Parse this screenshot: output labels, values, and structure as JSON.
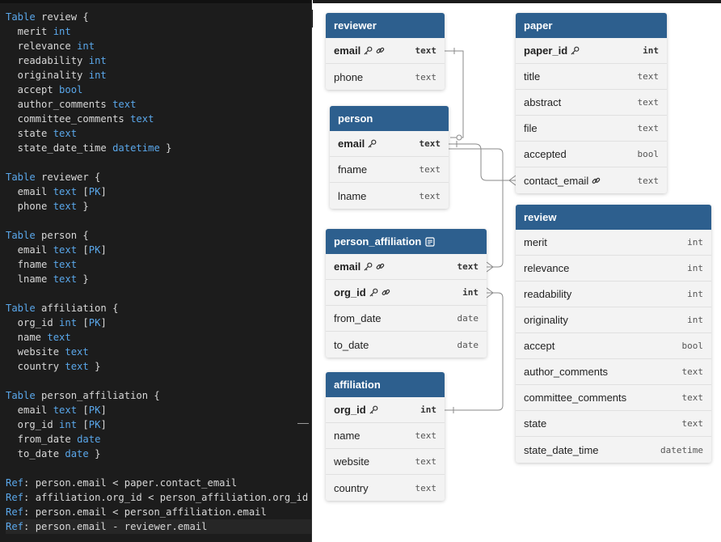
{
  "editor": {
    "lines": [
      [
        {
          "c": "k",
          "t": "Table"
        },
        {
          "c": "p",
          "t": " review {"
        }
      ],
      [
        {
          "c": "p",
          "t": "  merit "
        },
        {
          "c": "t",
          "t": "int"
        }
      ],
      [
        {
          "c": "p",
          "t": "  relevance "
        },
        {
          "c": "t",
          "t": "int"
        }
      ],
      [
        {
          "c": "p",
          "t": "  readability "
        },
        {
          "c": "t",
          "t": "int"
        }
      ],
      [
        {
          "c": "p",
          "t": "  originality "
        },
        {
          "c": "t",
          "t": "int"
        }
      ],
      [
        {
          "c": "p",
          "t": "  accept "
        },
        {
          "c": "t",
          "t": "bool"
        }
      ],
      [
        {
          "c": "p",
          "t": "  author_comments "
        },
        {
          "c": "t",
          "t": "text"
        }
      ],
      [
        {
          "c": "p",
          "t": "  committee_comments "
        },
        {
          "c": "t",
          "t": "text"
        }
      ],
      [
        {
          "c": "p",
          "t": "  state "
        },
        {
          "c": "t",
          "t": "text"
        }
      ],
      [
        {
          "c": "p",
          "t": "  state_date_time "
        },
        {
          "c": "t",
          "t": "datetime"
        },
        {
          "c": "p",
          "t": " }"
        }
      ],
      [],
      [
        {
          "c": "k",
          "t": "Table"
        },
        {
          "c": "p",
          "t": " reviewer {"
        }
      ],
      [
        {
          "c": "p",
          "t": "  email "
        },
        {
          "c": "t",
          "t": "text"
        },
        {
          "c": "p",
          "t": " ["
        },
        {
          "c": "k",
          "t": "PK"
        },
        {
          "c": "p",
          "t": "]"
        }
      ],
      [
        {
          "c": "p",
          "t": "  phone "
        },
        {
          "c": "t",
          "t": "text"
        },
        {
          "c": "p",
          "t": " }"
        }
      ],
      [],
      [
        {
          "c": "k",
          "t": "Table"
        },
        {
          "c": "p",
          "t": " person {"
        }
      ],
      [
        {
          "c": "p",
          "t": "  email "
        },
        {
          "c": "t",
          "t": "text"
        },
        {
          "c": "p",
          "t": " ["
        },
        {
          "c": "k",
          "t": "PK"
        },
        {
          "c": "p",
          "t": "]"
        }
      ],
      [
        {
          "c": "p",
          "t": "  fname "
        },
        {
          "c": "t",
          "t": "text"
        }
      ],
      [
        {
          "c": "p",
          "t": "  lname "
        },
        {
          "c": "t",
          "t": "text"
        },
        {
          "c": "p",
          "t": " }"
        }
      ],
      [],
      [
        {
          "c": "k",
          "t": "Table"
        },
        {
          "c": "p",
          "t": " affiliation {"
        }
      ],
      [
        {
          "c": "p",
          "t": "  org_id "
        },
        {
          "c": "t",
          "t": "int"
        },
        {
          "c": "p",
          "t": " ["
        },
        {
          "c": "k",
          "t": "PK"
        },
        {
          "c": "p",
          "t": "]"
        }
      ],
      [
        {
          "c": "p",
          "t": "  name "
        },
        {
          "c": "t",
          "t": "text"
        }
      ],
      [
        {
          "c": "p",
          "t": "  website "
        },
        {
          "c": "t",
          "t": "text"
        }
      ],
      [
        {
          "c": "p",
          "t": "  country "
        },
        {
          "c": "t",
          "t": "text"
        },
        {
          "c": "p",
          "t": " }"
        }
      ],
      [],
      [
        {
          "c": "k",
          "t": "Table"
        },
        {
          "c": "p",
          "t": " person_affiliation {"
        }
      ],
      [
        {
          "c": "p",
          "t": "  email "
        },
        {
          "c": "t",
          "t": "text"
        },
        {
          "c": "p",
          "t": " ["
        },
        {
          "c": "k",
          "t": "PK"
        },
        {
          "c": "p",
          "t": "]"
        }
      ],
      [
        {
          "c": "p",
          "t": "  org_id "
        },
        {
          "c": "t",
          "t": "int"
        },
        {
          "c": "p",
          "t": " ["
        },
        {
          "c": "k",
          "t": "PK"
        },
        {
          "c": "p",
          "t": "]"
        }
      ],
      [
        {
          "c": "p",
          "t": "  from_date "
        },
        {
          "c": "t",
          "t": "date"
        }
      ],
      [
        {
          "c": "p",
          "t": "  to_date "
        },
        {
          "c": "t",
          "t": "date"
        },
        {
          "c": "p",
          "t": " }"
        }
      ],
      [],
      [
        {
          "c": "k",
          "t": "Ref"
        },
        {
          "c": "p",
          "t": ": person.email < paper.contact_email"
        }
      ],
      [
        {
          "c": "k",
          "t": "Ref"
        },
        {
          "c": "p",
          "t": ": affiliation.org_id < person_affiliation.org_id"
        }
      ],
      [
        {
          "c": "k",
          "t": "Ref"
        },
        {
          "c": "p",
          "t": ": person.email < person_affiliation.email"
        }
      ],
      [
        {
          "c": "k",
          "t": "Ref"
        },
        {
          "c": "p",
          "t": ": person.email - reviewer.email"
        }
      ]
    ]
  },
  "colors": {
    "header": "#2d5f8e",
    "keyword": "#5aa7ea",
    "link": "#8a8a8a"
  },
  "tables": [
    {
      "id": "reviewer",
      "name": "reviewer",
      "note_icon": false,
      "fields": [
        {
          "name": "email",
          "type": "text",
          "pk": true,
          "key_icon": true,
          "ref_icon": true
        },
        {
          "name": "phone",
          "type": "text",
          "pk": false,
          "key_icon": false,
          "ref_icon": false
        }
      ]
    },
    {
      "id": "paper",
      "name": "paper",
      "note_icon": false,
      "fields": [
        {
          "name": "paper_id",
          "type": "int",
          "pk": true,
          "key_icon": true,
          "ref_icon": false
        },
        {
          "name": "title",
          "type": "text",
          "pk": false,
          "key_icon": false,
          "ref_icon": false
        },
        {
          "name": "abstract",
          "type": "text",
          "pk": false,
          "key_icon": false,
          "ref_icon": false
        },
        {
          "name": "file",
          "type": "text",
          "pk": false,
          "key_icon": false,
          "ref_icon": false
        },
        {
          "name": "accepted",
          "type": "bool",
          "pk": false,
          "key_icon": false,
          "ref_icon": false
        },
        {
          "name": "contact_email",
          "type": "text",
          "pk": false,
          "key_icon": false,
          "ref_icon": true
        }
      ]
    },
    {
      "id": "person",
      "name": "person",
      "note_icon": false,
      "fields": [
        {
          "name": "email",
          "type": "text",
          "pk": true,
          "key_icon": true,
          "ref_icon": false
        },
        {
          "name": "fname",
          "type": "text",
          "pk": false,
          "key_icon": false,
          "ref_icon": false
        },
        {
          "name": "lname",
          "type": "text",
          "pk": false,
          "key_icon": false,
          "ref_icon": false
        }
      ]
    },
    {
      "id": "review",
      "name": "review",
      "note_icon": false,
      "fields": [
        {
          "name": "merit",
          "type": "int",
          "pk": false,
          "key_icon": false,
          "ref_icon": false
        },
        {
          "name": "relevance",
          "type": "int",
          "pk": false,
          "key_icon": false,
          "ref_icon": false
        },
        {
          "name": "readability",
          "type": "int",
          "pk": false,
          "key_icon": false,
          "ref_icon": false
        },
        {
          "name": "originality",
          "type": "int",
          "pk": false,
          "key_icon": false,
          "ref_icon": false
        },
        {
          "name": "accept",
          "type": "bool",
          "pk": false,
          "key_icon": false,
          "ref_icon": false
        },
        {
          "name": "author_comments",
          "type": "text",
          "pk": false,
          "key_icon": false,
          "ref_icon": false
        },
        {
          "name": "committee_comments",
          "type": "text",
          "pk": false,
          "key_icon": false,
          "ref_icon": false
        },
        {
          "name": "state",
          "type": "text",
          "pk": false,
          "key_icon": false,
          "ref_icon": false
        },
        {
          "name": "state_date_time",
          "type": "datetime",
          "pk": false,
          "key_icon": false,
          "ref_icon": false
        }
      ]
    },
    {
      "id": "person_affiliation",
      "name": "person_affiliation",
      "note_icon": true,
      "fields": [
        {
          "name": "email",
          "type": "text",
          "pk": true,
          "key_icon": true,
          "ref_icon": true
        },
        {
          "name": "org_id",
          "type": "int",
          "pk": true,
          "key_icon": true,
          "ref_icon": true
        },
        {
          "name": "from_date",
          "type": "date",
          "pk": false,
          "key_icon": false,
          "ref_icon": false
        },
        {
          "name": "to_date",
          "type": "date",
          "pk": false,
          "key_icon": false,
          "ref_icon": false
        }
      ]
    },
    {
      "id": "affiliation",
      "name": "affiliation",
      "note_icon": false,
      "fields": [
        {
          "name": "org_id",
          "type": "int",
          "pk": true,
          "key_icon": true,
          "ref_icon": false
        },
        {
          "name": "name",
          "type": "text",
          "pk": false,
          "key_icon": false,
          "ref_icon": false
        },
        {
          "name": "website",
          "type": "text",
          "pk": false,
          "key_icon": false,
          "ref_icon": false
        },
        {
          "name": "country",
          "type": "text",
          "pk": false,
          "key_icon": false,
          "ref_icon": false
        }
      ]
    }
  ]
}
